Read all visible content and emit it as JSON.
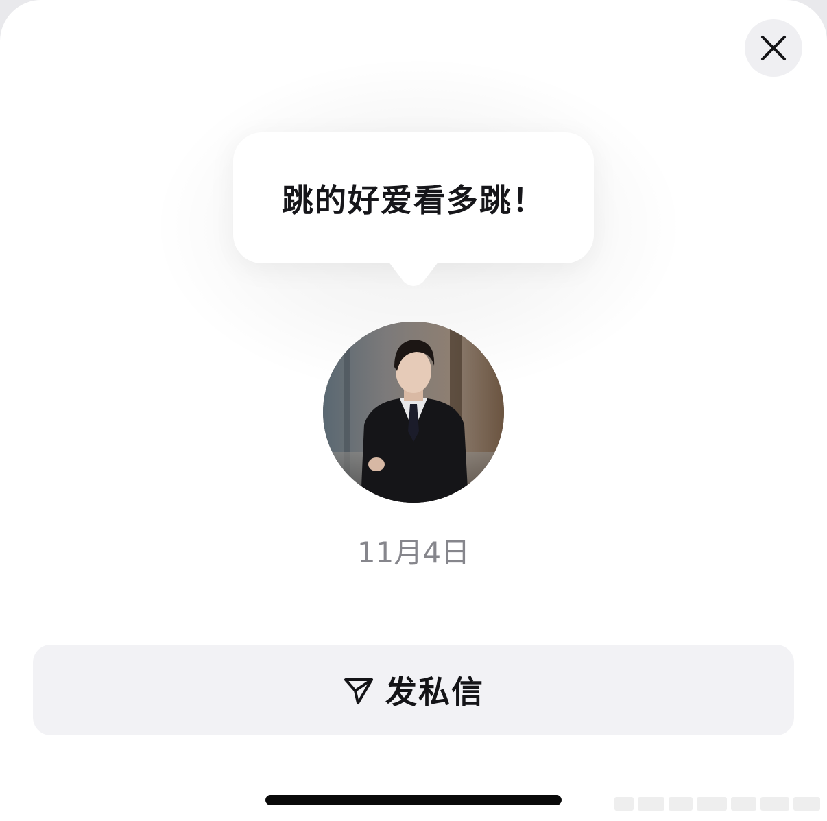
{
  "message": {
    "text": "跳的好爱看多跳！"
  },
  "sender": {
    "avatar": "profile-photo"
  },
  "date": "11月4日",
  "actions": {
    "direct_message_label": "发私信",
    "direct_message_icon": "send-icon",
    "close_icon": "close-icon"
  },
  "colors": {
    "background": "#ffffff",
    "button_bg": "#f2f2f5",
    "close_bg": "#efeff2",
    "date_text": "#86868c",
    "primary_text": "#16161a"
  }
}
